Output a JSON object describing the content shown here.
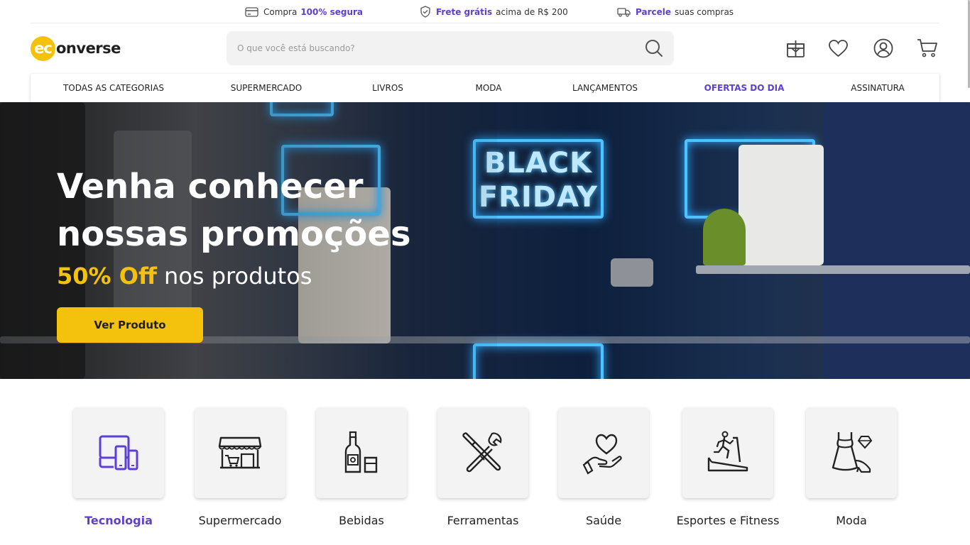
{
  "topbar": {
    "secure": {
      "prefix": "Compra",
      "highlight": "100% segura"
    },
    "shipping": {
      "highlight": "Frete grátis",
      "suffix": "acima de R$ 200"
    },
    "installments": {
      "highlight": "Parcele",
      "suffix": "suas compras"
    }
  },
  "logo": {
    "circle_text": "ec",
    "rest_text": "onverse"
  },
  "search": {
    "placeholder": "O que você está buscando?",
    "value": ""
  },
  "header_icons": [
    "gift-icon",
    "heart-icon",
    "user-icon",
    "cart-icon"
  ],
  "nav": {
    "items": [
      {
        "label": "TODAS AS CATEGORIAS",
        "highlight": false
      },
      {
        "label": "SUPERMERCADO",
        "highlight": false
      },
      {
        "label": "LIVROS",
        "highlight": false
      },
      {
        "label": "MODA",
        "highlight": false
      },
      {
        "label": "LANÇAMENTOS",
        "highlight": false
      },
      {
        "label": "OFERTAS DO DIA",
        "highlight": true
      },
      {
        "label": "ASSINATURA",
        "highlight": false
      }
    ]
  },
  "hero": {
    "title": "Venha conhecer nossas promoções",
    "subtitle_accent": "50% Off",
    "subtitle_rest": "nos produtos",
    "cta_label": "Ver Produto",
    "sign_text_1": "BLACK",
    "sign_text_2": "FRIDAY"
  },
  "categories": [
    {
      "label": "Tecnologia",
      "icon": "devices-icon",
      "active": true
    },
    {
      "label": "Supermercado",
      "icon": "store-icon",
      "active": false
    },
    {
      "label": "Bebidas",
      "icon": "bottle-icon",
      "active": false
    },
    {
      "label": "Ferramentas",
      "icon": "tools-icon",
      "active": false
    },
    {
      "label": "Saúde",
      "icon": "health-heart-hand-icon",
      "active": false
    },
    {
      "label": "Esportes e Fitness",
      "icon": "treadmill-icon",
      "active": false
    },
    {
      "label": "Moda",
      "icon": "dress-icon",
      "active": false
    }
  ],
  "colors": {
    "brand": "#5d3fd3",
    "accent": "#f4c20d",
    "text": "#1f1f1f"
  }
}
